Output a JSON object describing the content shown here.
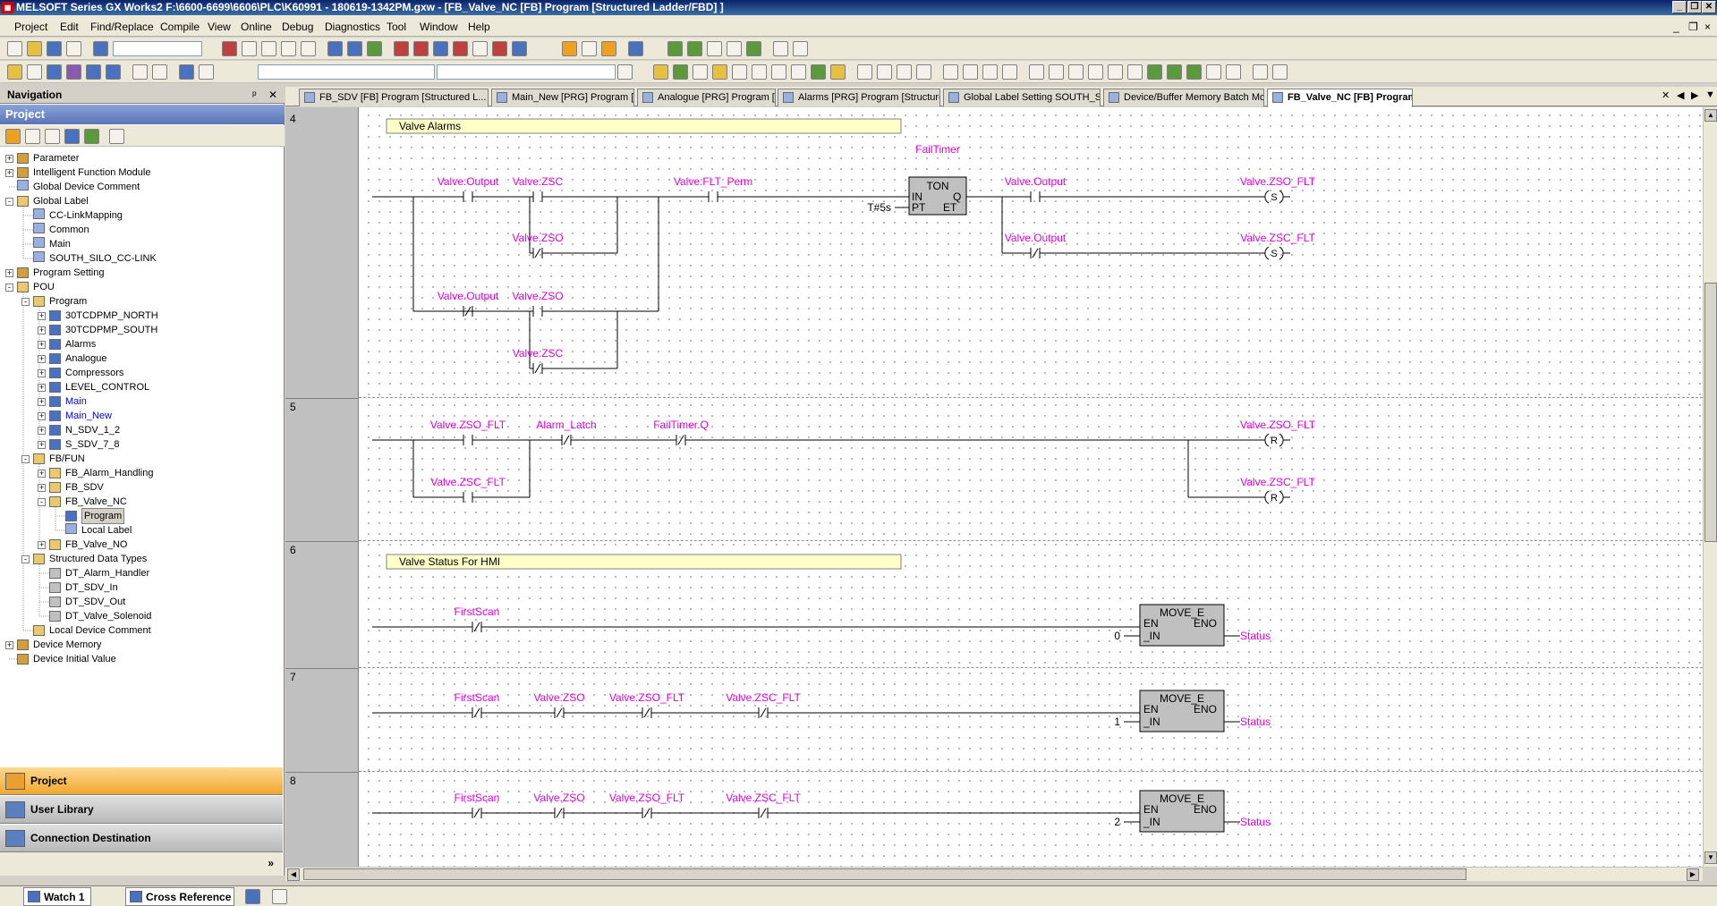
{
  "window": {
    "title": "MELSOFT Series GX Works2 F:\\6600-6699\\6606\\PLC\\K60991 - 180619-1342PM.gxw - [FB_Valve_NC [FB] Program [Structured Ladder/FBD] ]",
    "min": "_",
    "restore": "❐",
    "close": "✕",
    "mdi_min": "_",
    "mdi_restore": "❐",
    "mdi_close": "×"
  },
  "menu": [
    "Project",
    "Edit",
    "Find/Replace",
    "Compile",
    "View",
    "Online",
    "Debug",
    "Diagnostics",
    "Tool",
    "Window",
    "Help"
  ],
  "navigation": {
    "title": "Navigation",
    "pin": "ᵖ",
    "close": "✕",
    "project_header": "Project"
  },
  "tree": [
    {
      "label": "Parameter",
      "level": 0,
      "exp": "+",
      "icon": "par"
    },
    {
      "label": "Intelligent Function Module",
      "level": 0,
      "exp": "+",
      "icon": "par"
    },
    {
      "label": "Global Device Comment",
      "level": 0,
      "exp": "",
      "icon": "lbl"
    },
    {
      "label": "Global Label",
      "level": 0,
      "exp": "-",
      "icon": "folder"
    },
    {
      "label": "CC-LinkMapping",
      "level": 1,
      "exp": "",
      "icon": "lbl"
    },
    {
      "label": "Common",
      "level": 1,
      "exp": "",
      "icon": "lbl"
    },
    {
      "label": "Main",
      "level": 1,
      "exp": "",
      "icon": "lbl"
    },
    {
      "label": "SOUTH_SILO_CC-LINK",
      "level": 1,
      "exp": "",
      "icon": "lbl"
    },
    {
      "label": "Program Setting",
      "level": 0,
      "exp": "+",
      "icon": "par"
    },
    {
      "label": "POU",
      "level": 0,
      "exp": "-",
      "icon": "folder"
    },
    {
      "label": "Program",
      "level": 1,
      "exp": "-",
      "icon": "folder"
    },
    {
      "label": "30TCDPMP_NORTH",
      "level": 2,
      "exp": "+",
      "icon": "pou"
    },
    {
      "label": "30TCDPMP_SOUTH",
      "level": 2,
      "exp": "+",
      "icon": "pou"
    },
    {
      "label": "Alarms",
      "level": 2,
      "exp": "+",
      "icon": "pou"
    },
    {
      "label": "Analogue",
      "level": 2,
      "exp": "+",
      "icon": "pou"
    },
    {
      "label": "Compressors",
      "level": 2,
      "exp": "+",
      "icon": "pou"
    },
    {
      "label": "LEVEL_CONTROL",
      "level": 2,
      "exp": "+",
      "icon": "pou"
    },
    {
      "label": "Main",
      "level": 2,
      "exp": "+",
      "icon": "pou",
      "color": "blue"
    },
    {
      "label": "Main_New",
      "level": 2,
      "exp": "+",
      "icon": "pou",
      "color": "blue"
    },
    {
      "label": "N_SDV_1_2",
      "level": 2,
      "exp": "+",
      "icon": "pou"
    },
    {
      "label": "S_SDV_7_8",
      "level": 2,
      "exp": "+",
      "icon": "pou"
    },
    {
      "label": "FB/FUN",
      "level": 1,
      "exp": "-",
      "icon": "folder"
    },
    {
      "label": "FB_Alarm_Handling",
      "level": 2,
      "exp": "+",
      "icon": "folder"
    },
    {
      "label": "FB_SDV",
      "level": 2,
      "exp": "+",
      "icon": "folder"
    },
    {
      "label": "FB_Valve_NC",
      "level": 2,
      "exp": "-",
      "icon": "folder"
    },
    {
      "label": "Program",
      "level": 3,
      "exp": "",
      "icon": "pou",
      "selected": true
    },
    {
      "label": "Local Label",
      "level": 3,
      "exp": "",
      "icon": "lbl"
    },
    {
      "label": "FB_Valve_NO",
      "level": 2,
      "exp": "+",
      "icon": "folder"
    },
    {
      "label": "Structured Data Types",
      "level": 1,
      "exp": "-",
      "icon": "folder"
    },
    {
      "label": "DT_Alarm_Handler",
      "level": 2,
      "exp": "",
      "icon": "dt"
    },
    {
      "label": "DT_SDV_In",
      "level": 2,
      "exp": "",
      "icon": "dt"
    },
    {
      "label": "DT_SDV_Out",
      "level": 2,
      "exp": "",
      "icon": "dt"
    },
    {
      "label": "DT_Valve_Solenoid",
      "level": 2,
      "exp": "",
      "icon": "dt"
    },
    {
      "label": "Local Device Comment",
      "level": 1,
      "exp": "",
      "icon": "folder"
    },
    {
      "label": "Device Memory",
      "level": 0,
      "exp": "+",
      "icon": "par"
    },
    {
      "label": "Device Initial Value",
      "level": 0,
      "exp": "",
      "icon": "par"
    }
  ],
  "nav_buttons": [
    {
      "label": "Project",
      "active": true
    },
    {
      "label": "User Library",
      "active": false
    },
    {
      "label": "Connection Destination",
      "active": false
    }
  ],
  "nav_more": "»",
  "tabs": [
    {
      "label": "FB_SDV [FB] Program [Structured L...",
      "active": false
    },
    {
      "label": "Main_New [PRG] Program [Structur...",
      "active": false
    },
    {
      "label": "Analogue [PRG] Program [Structure...",
      "active": false
    },
    {
      "label": "Alarms [PRG] Program [Structured L...",
      "active": false
    },
    {
      "label": "Global Label Setting SOUTH_SILO_...",
      "active": false
    },
    {
      "label": "Device/Buffer Memory Batch Monito...",
      "active": false
    },
    {
      "label": "FB_Valve_NC [FB] Program ...",
      "active": true
    }
  ],
  "tab_close": "✕",
  "tab_nav": [
    "◀",
    "▶",
    "▼"
  ],
  "ladder": {
    "rows": [
      {
        "number": "4",
        "comment": "Valve Alarms"
      },
      {
        "number": "5",
        "comment": ""
      },
      {
        "number": "6",
        "comment": "Valve Status For HMI"
      },
      {
        "number": "7",
        "comment": ""
      },
      {
        "number": "8",
        "comment": ""
      }
    ],
    "r4": {
      "c1": "Valve.Output",
      "c2": "Valve.ZSC",
      "c3": "Valve.ZSO",
      "c4": "Valve.FLT_Perm",
      "c5": "Valve.Output",
      "c6": "Valve.ZSO",
      "c7": "Valve.ZSC",
      "timer_name": "FailTimer",
      "timer_type": "TON",
      "timer_in": "IN",
      "timer_pt": "PT",
      "timer_q": "Q",
      "timer_et": "ET",
      "timer_preset": "T#5s",
      "o1_contact": "Valve.Output",
      "o1_coil": "Valve.ZSO_FLT",
      "o1_set": "S",
      "o2_contact": "Valve.Output",
      "o2_coil": "Valve.ZSC_FLT",
      "o2_set": "S"
    },
    "r5": {
      "c1": "Valve.ZSO_FLT",
      "c2": "Valve.ZSC_FLT",
      "c3": "Alarm_Latch",
      "c4": "FailTimer.Q",
      "o1": "Valve.ZSO_FLT",
      "o2": "Valve.ZSC_FLT",
      "reset": "R"
    },
    "fb_move": {
      "name": "MOVE_E",
      "en": "EN",
      "eno": "ENO",
      "in": "_IN",
      "out": "Status"
    },
    "r6": {
      "c1": "FirstScan",
      "value": "0"
    },
    "r7": {
      "c1": "FirstScan",
      "c2": "Valve.ZSO",
      "c3": "Valve.ZSO_FLT",
      "c4": "Valve.ZSC_FLT",
      "value": "1"
    },
    "r8": {
      "c1": "FirstScan",
      "c2": "Valve.ZSO",
      "c3": "Valve.ZSO_FLT",
      "c4": "Valve.ZSC_FLT",
      "value": "2"
    }
  },
  "scroll": {
    "up": "▲",
    "down": "▼",
    "left": "◀",
    "right": "▶"
  },
  "statusbar": {
    "tabs": [
      "Watch 1",
      "Cross Reference"
    ]
  },
  "colors": {
    "label_magenta": "#e000e0",
    "comment_bg": "#ffffc8",
    "fb_fill": "#c0c0c0",
    "titlebar": "#0a246a"
  }
}
